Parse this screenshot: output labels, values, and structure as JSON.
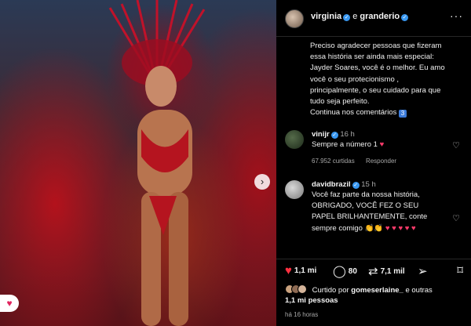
{
  "post": {
    "author": "virginia",
    "connector": "e",
    "coauthor": "granderio",
    "caption_lines": [
      "Preciso agradecer pessoas que fizeram",
      "essa história ser ainda mais especial:",
      "Jayder Soares, você é o melhor. Eu amo",
      "você o seu protecionismo ,",
      "principalmente, o seu cuidado para que",
      "tudo seja perfeito.",
      "Continua nos comentários"
    ],
    "caption_emoji": "3"
  },
  "comments": [
    {
      "username": "vinijr",
      "time": "16 h",
      "text": "Sempre a número 1",
      "emoji": "♥",
      "likes": "67.952 curtidas",
      "reply": "Responder"
    },
    {
      "username": "davidbrazil",
      "time": "15 h",
      "lines": [
        "Você faz parte da nossa história,",
        "OBRIGADO, VOCÊ FEZ O SEU",
        "PAPEL BRILHANTEMENTE, conte"
      ],
      "last_line": "sempre comigo",
      "emojis": "👏👏 ♥ ♥ ♥ ♥ ♥"
    }
  ],
  "actions": {
    "likes": "1,1 mi",
    "comments": "80",
    "shares": "7,1 mil"
  },
  "liked_by": {
    "prefix": "Curtido por",
    "user": "gomeserlaine_",
    "middle": "e outras",
    "count": "1,1 mi pessoas"
  },
  "time_ago": "há 16 horas",
  "colors": {
    "verified": "#3897f0",
    "like_red": "#ff3040",
    "heart_pink": "#ff3b6b",
    "muted": "#a8a8a8"
  }
}
